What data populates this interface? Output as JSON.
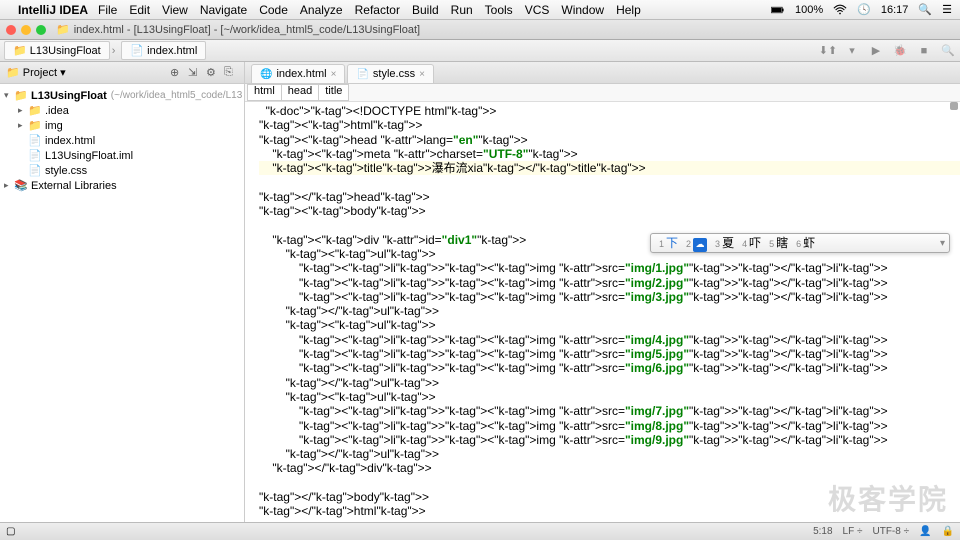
{
  "menubar": {
    "app": "IntelliJ IDEA",
    "items": [
      "File",
      "Edit",
      "View",
      "Navigate",
      "Code",
      "Analyze",
      "Refactor",
      "Build",
      "Run",
      "Tools",
      "VCS",
      "Window",
      "Help"
    ],
    "battery": "100%",
    "time": "16:17"
  },
  "window": {
    "title": "index.html - [L13UsingFloat] - [~/work/idea_html5_code/L13UsingFloat]"
  },
  "breadcrumb": {
    "items": [
      "L13UsingFloat",
      "index.html"
    ]
  },
  "project": {
    "header": "Project",
    "root": {
      "name": "L13UsingFloat",
      "path": "(~/work/idea_html5_code/L13"
    },
    "children": [
      {
        "name": ".idea",
        "icon": "📁",
        "indent": "l1",
        "arrow": "▸"
      },
      {
        "name": "img",
        "icon": "📁",
        "indent": "l1",
        "arrow": "▸"
      },
      {
        "name": "index.html",
        "icon": "📄",
        "indent": "l1",
        "arrow": ""
      },
      {
        "name": "L13UsingFloat.iml",
        "icon": "📄",
        "indent": "l1",
        "arrow": ""
      },
      {
        "name": "style.css",
        "icon": "📄",
        "indent": "l1",
        "arrow": ""
      }
    ],
    "ext_lib": "External Libraries"
  },
  "tabs": [
    {
      "label": "index.html",
      "icon": "🌐"
    },
    {
      "label": "style.css",
      "icon": "📄"
    }
  ],
  "code_breadcrumb": [
    "html",
    "head",
    "title"
  ],
  "code_lines": [
    {
      "t": "  <!DOCTYPE html>",
      "cls": ""
    },
    {
      "t": "<html>",
      "cls": ""
    },
    {
      "t": "<head lang=\"en\">",
      "cls": ""
    },
    {
      "t": "    <meta charset=\"UTF-8\">",
      "cls": ""
    },
    {
      "t": "    <title>瀑布流xia</title>",
      "cls": "highlight-line"
    },
    {
      "t": "",
      "cls": ""
    },
    {
      "t": "</head>",
      "cls": ""
    },
    {
      "t": "<body>",
      "cls": ""
    },
    {
      "t": "",
      "cls": ""
    },
    {
      "t": "    <div id=\"div1\">",
      "cls": ""
    },
    {
      "t": "        <ul>",
      "cls": ""
    },
    {
      "t": "            <li><img src=\"img/1.jpg\"></li>",
      "cls": ""
    },
    {
      "t": "            <li><img src=\"img/2.jpg\"></li>",
      "cls": ""
    },
    {
      "t": "            <li><img src=\"img/3.jpg\"></li>",
      "cls": ""
    },
    {
      "t": "        </ul>",
      "cls": ""
    },
    {
      "t": "        <ul>",
      "cls": ""
    },
    {
      "t": "            <li><img src=\"img/4.jpg\"></li>",
      "cls": ""
    },
    {
      "t": "            <li><img src=\"img/5.jpg\"></li>",
      "cls": ""
    },
    {
      "t": "            <li><img src=\"img/6.jpg\"></li>",
      "cls": ""
    },
    {
      "t": "        </ul>",
      "cls": ""
    },
    {
      "t": "        <ul>",
      "cls": ""
    },
    {
      "t": "            <li><img src=\"img/7.jpg\"></li>",
      "cls": ""
    },
    {
      "t": "            <li><img src=\"img/8.jpg\"></li>",
      "cls": ""
    },
    {
      "t": "            <li><img src=\"img/9.jpg\"></li>",
      "cls": ""
    },
    {
      "t": "        </ul>",
      "cls": ""
    },
    {
      "t": "    </div>",
      "cls": ""
    },
    {
      "t": "",
      "cls": ""
    },
    {
      "t": "</body>",
      "cls": ""
    },
    {
      "t": "</html>",
      "cls": ""
    }
  ],
  "ime": {
    "candidates": [
      {
        "n": "1",
        "c": "下",
        "sel": true
      },
      {
        "n": "2",
        "c": "",
        "cloud": true
      },
      {
        "n": "3",
        "c": "夏"
      },
      {
        "n": "4",
        "c": "吓"
      },
      {
        "n": "5",
        "c": "瞎"
      },
      {
        "n": "6",
        "c": "虾"
      }
    ]
  },
  "status": {
    "pos": "5:18",
    "lf": "LF ÷",
    "enc": "UTF-8 ÷",
    "lock": "🔒"
  },
  "watermark": "极客学院"
}
